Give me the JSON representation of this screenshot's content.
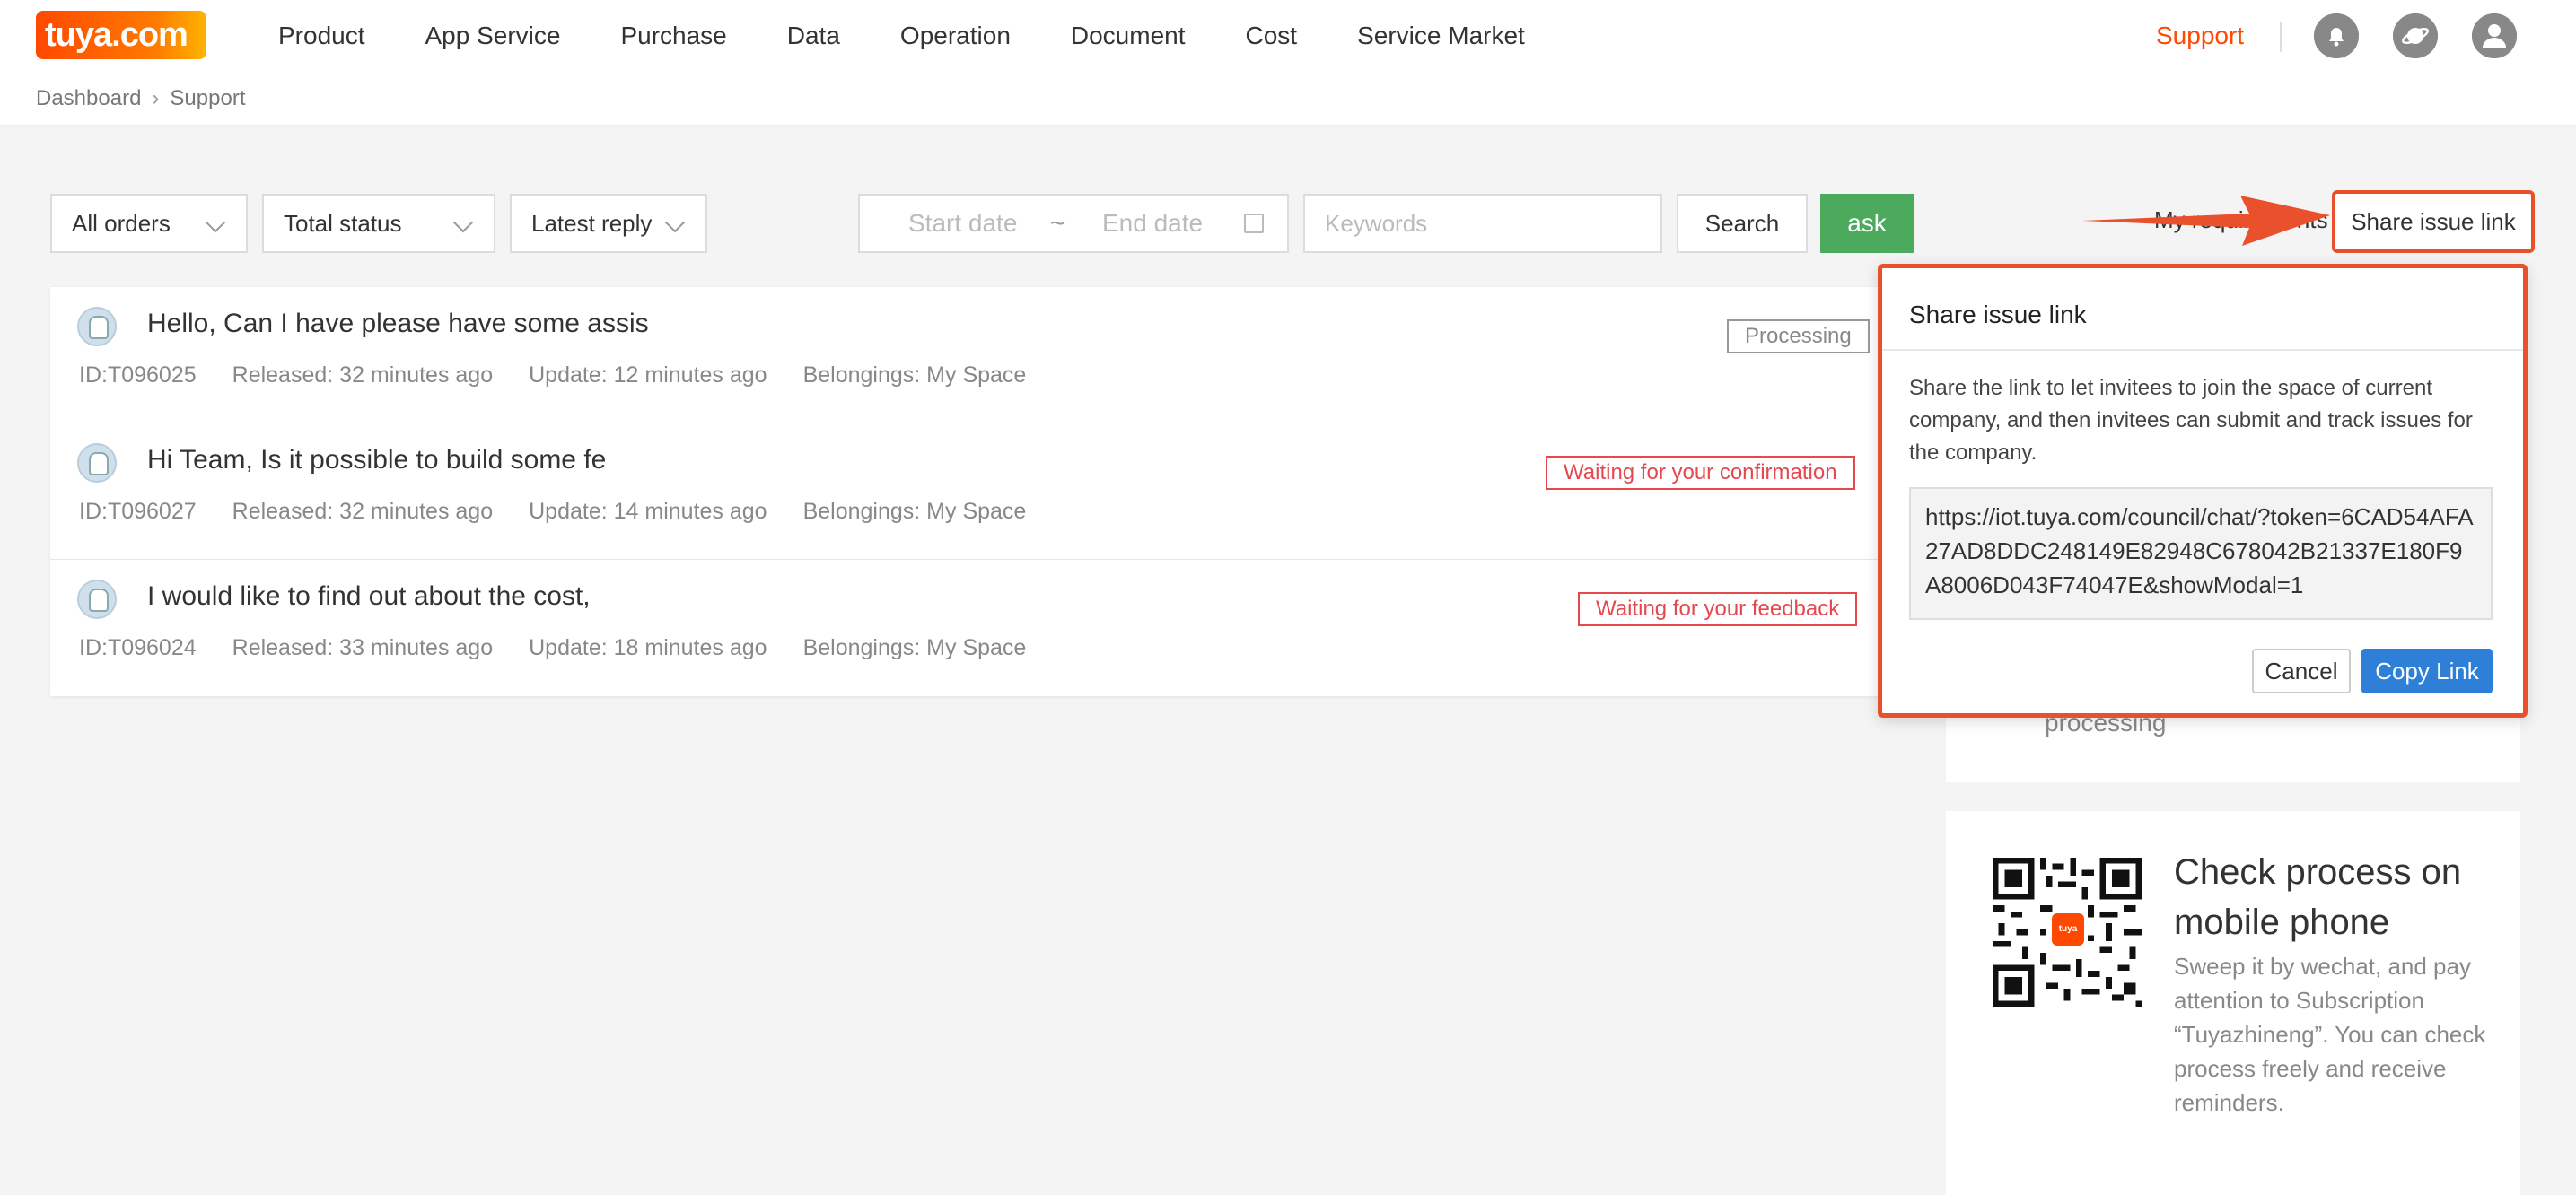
{
  "header": {
    "logo": "tuya.com",
    "nav": [
      "Product",
      "App Service",
      "Purchase",
      "Data",
      "Operation",
      "Document",
      "Cost",
      "Service Market"
    ],
    "support": "Support",
    "icons": [
      "bell-icon",
      "planet-icon",
      "user-icon"
    ]
  },
  "breadcrumb": {
    "home": "Dashboard",
    "current": "Support"
  },
  "filters": {
    "orders": "All orders",
    "status": "Total status",
    "sort": "Latest reply",
    "start_date": "Start date",
    "tilde": "~",
    "end_date": "End date",
    "keywords_placeholder": "Keywords",
    "search": "Search",
    "ask": "ask",
    "my_requirements": "My requirements",
    "share_issue_link": "Share issue link"
  },
  "issues": [
    {
      "title": "Hello, Can I have please have some assis",
      "id": "ID:T096025",
      "released": "Released: 32 minutes ago",
      "update": "Update: 12 minutes ago",
      "belongings": "Belongings: My Space",
      "status": "Processing"
    },
    {
      "title": "Hi Team, Is it possible to build some fe",
      "id": "ID:T096027",
      "released": "Released: 32 minutes ago",
      "update": "Update: 14 minutes ago",
      "belongings": "Belongings: My Space",
      "status": "Waiting for your confirmation"
    },
    {
      "title": "I would like to find out about the cost,",
      "id": "ID:T096024",
      "released": "Released: 33 minutes ago",
      "update": "Update: 18 minutes ago",
      "belongings": "Belongings: My Space",
      "status": "Waiting for your feedback"
    }
  ],
  "side": {
    "processing": "processing",
    "mobile_title": "Check process on mobile phone",
    "mobile_desc": "Sweep it by wechat, and pay attention to Subscription “Tuyazhineng”. You can check process freely and receive reminders.",
    "qr_logo": "tuya"
  },
  "popover": {
    "title": "Share issue link",
    "desc": "Share the link to let invitees to join the space of current company, and then invitees can submit and track issues for the company.",
    "link": "https://iot.tuya.com/council/chat/?token=6CAD54AFA27AD8DDC248149E82948C678042B21337E180F9A8006D043F74047E&showModal=1",
    "cancel": "Cancel",
    "copy": "Copy Link"
  },
  "colors": {
    "brand": "#ff4800",
    "annotation": "#e9502c",
    "ask": "#4caa5c",
    "primary": "#2d7fd8",
    "warning": "#e5484d"
  }
}
